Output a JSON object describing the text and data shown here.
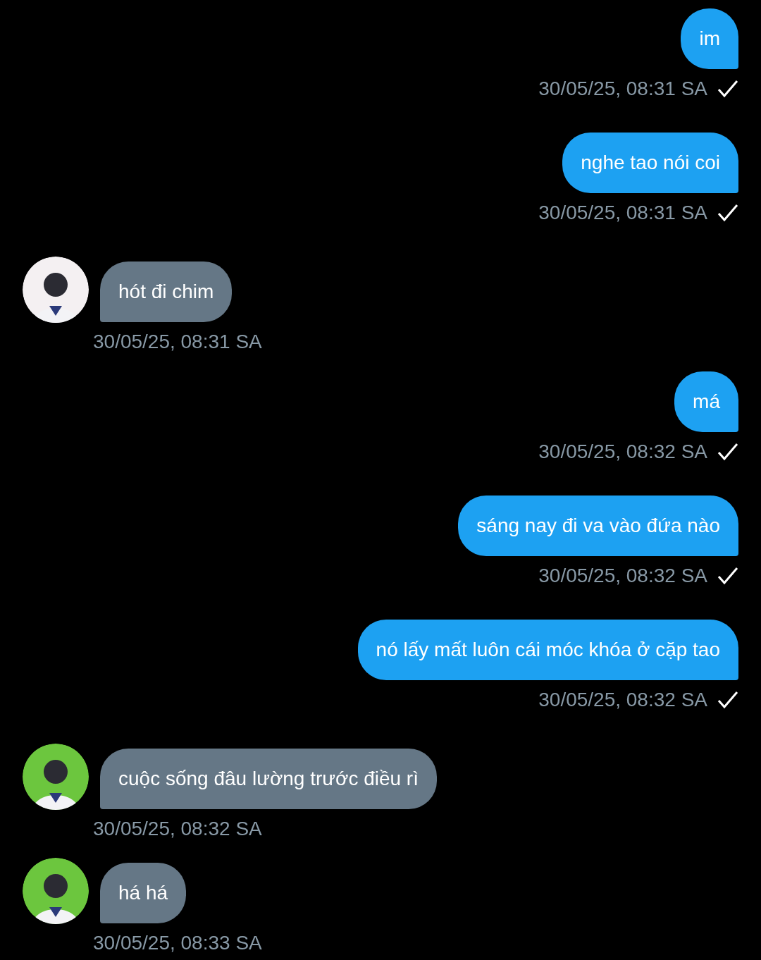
{
  "messages": [
    {
      "kind": "sent",
      "text": "im",
      "time": "30/05/25, 08:31 SA",
      "delivered": true
    },
    {
      "kind": "sent",
      "text": "nghe tao nói coi",
      "time": "30/05/25, 08:31 SA",
      "delivered": true
    },
    {
      "kind": "received",
      "text": "hót đi chim",
      "time": "30/05/25, 08:31 SA",
      "color": "#f4f0f2"
    },
    {
      "kind": "sent",
      "text": "má",
      "time": "30/05/25, 08:32 SA",
      "delivered": true
    },
    {
      "kind": "sent",
      "text": "sáng nay đi va vào đứa nào",
      "time": "30/05/25, 08:32 SA",
      "delivered": true
    },
    {
      "kind": "sent",
      "text": "nó lấy mất luôn cái móc khóa ở cặp tao",
      "time": "30/05/25, 08:32 SA",
      "delivered": true
    },
    {
      "kind": "received",
      "text": "cuộc sống đâu lường trước điều rì",
      "time": "30/05/25, 08:32 SA",
      "color": "#6cc63e"
    },
    {
      "kind": "received",
      "text": "há há",
      "time": "30/05/25, 08:33 SA",
      "color": "#6cc63e"
    }
  ]
}
